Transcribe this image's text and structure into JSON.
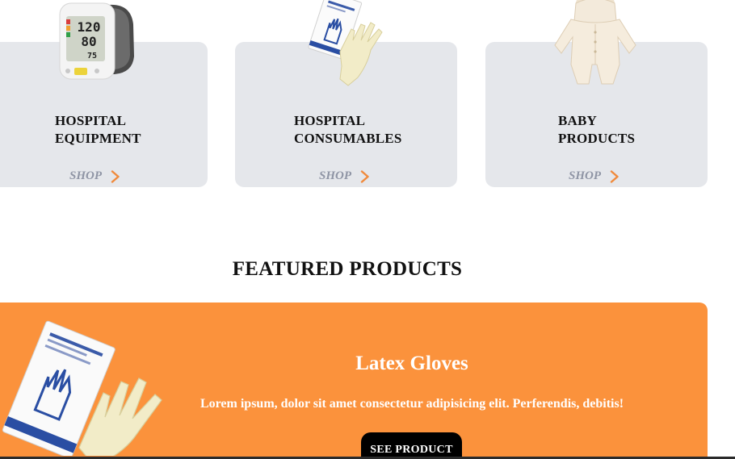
{
  "categories": [
    {
      "title": "HOSPITAL\nEQUIPMENT",
      "shop_label": "SHOP",
      "image_icon": "blood-pressure-monitor-icon",
      "monitor_readings": [
        "120",
        "80",
        "75"
      ]
    },
    {
      "title": "HOSPITAL\nCONSUMABLES",
      "shop_label": "SHOP",
      "image_icon": "surgical-gloves-icon"
    },
    {
      "title": "BABY\nPRODUCTS",
      "shop_label": "SHOP",
      "image_icon": "baby-romper-icon"
    }
  ],
  "featured": {
    "section_title": "FEATURED PRODUCTS",
    "product_name": "Latex Gloves",
    "description": "Lorem ipsum, dolor sit amet consectetur adipisicing elit. Perferendis, debitis!",
    "button_label": "SEE PRODUCT",
    "image_icon": "latex-gloves-package-icon"
  },
  "colors": {
    "card_bg": "#e5e7eb",
    "shop_text": "#8f95a5",
    "chevron": "#f08a3c",
    "featured_bg": "#fb923c",
    "button_bg": "#000000",
    "text_dark": "#111111"
  }
}
